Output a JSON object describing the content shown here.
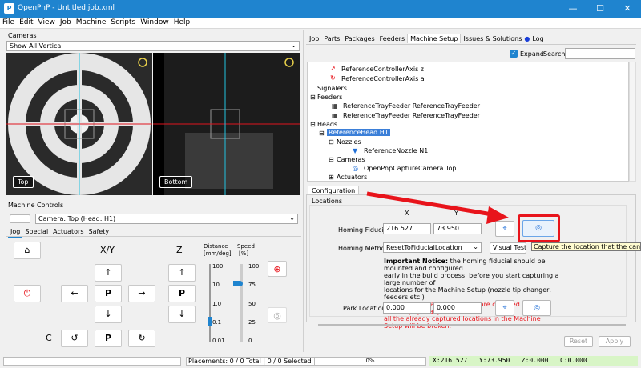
{
  "window": {
    "title": "OpenPnP - Untitled.job.xml",
    "logo": "P",
    "min": "—",
    "max": "☐",
    "close": "✕"
  },
  "menu": [
    "File",
    "Edit",
    "View",
    "Job",
    "Machine",
    "Scripts",
    "Window",
    "Help"
  ],
  "cameras": {
    "heading": "Cameras",
    "view_select": "Show All Vertical",
    "top_label": "Top",
    "bottom_label": "Bottom"
  },
  "machine_controls": {
    "heading": "Machine Controls",
    "camera_select": "Camera: Top (Head: H1)",
    "tabs": [
      "Jog",
      "Special",
      "Actuators",
      "Safety"
    ],
    "xy": "X/Y",
    "z": "Z",
    "c": "C",
    "p": "P",
    "distance_label": "Distance",
    "distance_unit": "[mm/deg]",
    "speed_label": "Speed",
    "speed_unit": "[%]",
    "distance_ticks": [
      "100",
      "10",
      "1.0",
      "0.1",
      "0.01"
    ],
    "speed_ticks": [
      "100",
      "75",
      "50",
      "25",
      "0"
    ],
    "distance_value": "0.1",
    "speed_value": 75
  },
  "right_tabs": [
    "Job",
    "Parts",
    "Packages",
    "Feeders",
    "Machine Setup",
    "Issues & Solutions",
    "Log"
  ],
  "expand": {
    "label": "Expand",
    "checked": true
  },
  "search_label": "Search",
  "tree": {
    "axis_z": "ReferenceControllerAxis z",
    "axis_a": "ReferenceControllerAxis a",
    "signalers": "Signalers",
    "feeders": "Feeders",
    "feeder1": "ReferenceTrayFeeder ReferenceTrayFeeder",
    "feeder2": "ReferenceTrayFeeder ReferenceTrayFeeder",
    "heads": "Heads",
    "head": "ReferenceHead H1",
    "nozzles": "Nozzles",
    "nozzle": "ReferenceNozzle N1",
    "cams": "Cameras",
    "camera": "OpenPnpCaptureCamera Top",
    "actuators": "Actuators"
  },
  "config": {
    "tab": "Configuration",
    "locations": "Locations",
    "col_x": "X",
    "col_y": "Y",
    "homing_fiducial_label": "Homing Fiducial",
    "homing_x": "216.527",
    "homing_y": "73.950",
    "homing_method_label": "Homing Method",
    "homing_method": "ResetToFiducialLocation",
    "visual_test": "Visual Test",
    "notice_bold": "Important Notice:",
    "notice_lines": [
      " the homing fiducial should be mounted and configured",
      "early in the build process, before you start capturing a large number of",
      "locations for the Machine Setup (nozzle tip changer, feeders etc.)"
    ],
    "warn_lines": [
      "Each time the above settings are changed or the fiducial physically moved,",
      "all the already captured locations in the Machine Setup will be broken."
    ],
    "park_label": "Park Location",
    "park_x": "0.000",
    "park_y": "0.000",
    "tooltip": "Capture the location that the camera is",
    "reset": "Reset",
    "apply": "Apply"
  },
  "status": {
    "placements": "Placements: 0 / 0 Total | 0 / 0 Selected Board",
    "progress": "0%",
    "x": "X:216.527",
    "y": "Y:73.950",
    "z": "Z:0.000",
    "c": "C:0.000"
  },
  "colors": {
    "titlebar": "#1f84cf",
    "arrow": "#e8141b",
    "highlight": "#e8141b",
    "selection": "#3b7fd8",
    "cross_red": "#e0141e",
    "cross_cyan": "#22c3e0"
  }
}
